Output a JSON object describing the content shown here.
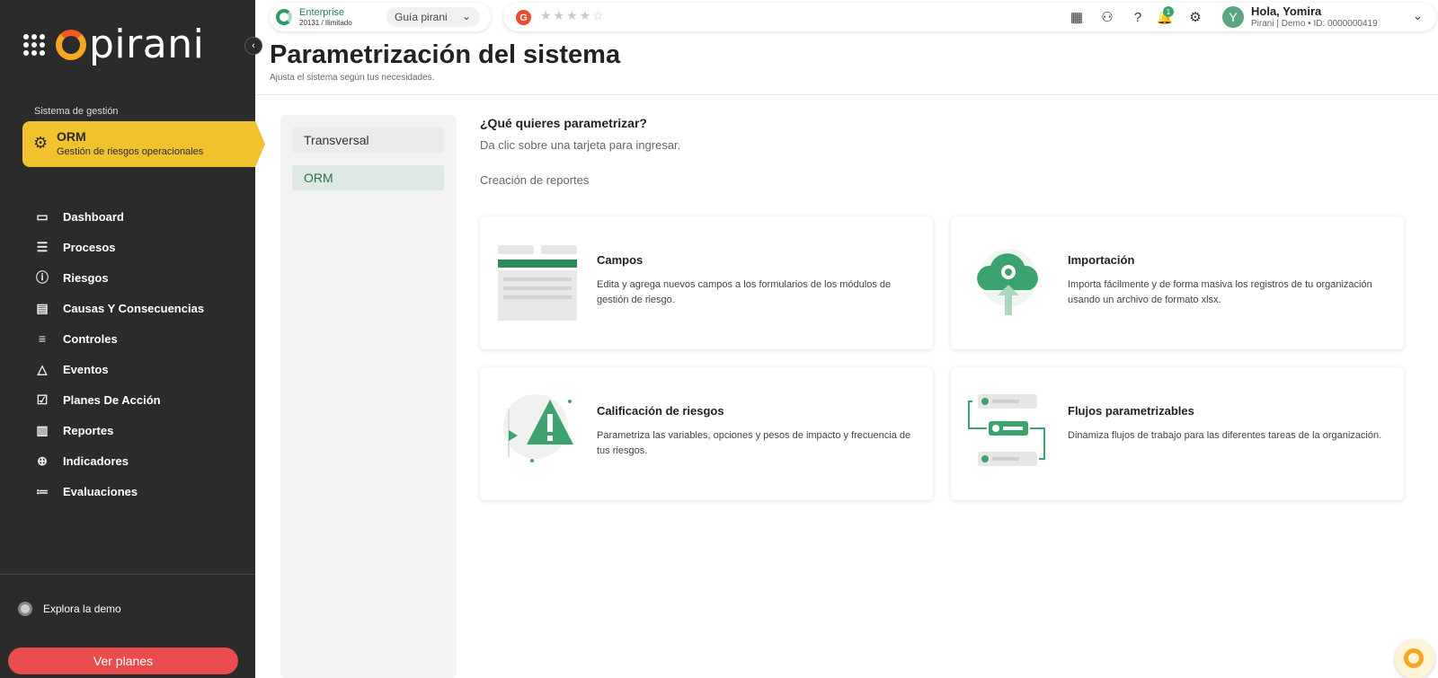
{
  "brand": {
    "logo_text": "pirani"
  },
  "sidebar": {
    "section_label": "Sistema de gestión",
    "active_module": {
      "title": "ORM",
      "subtitle": "Gestión de riesgos operacionales"
    },
    "items": [
      {
        "label": "Dashboard",
        "icon": "monitor-icon"
      },
      {
        "label": "Procesos",
        "icon": "list-icon"
      },
      {
        "label": "Riesgos",
        "icon": "alert-circle-icon"
      },
      {
        "label": "Causas Y Consecuencias",
        "icon": "cause-icon"
      },
      {
        "label": "Controles",
        "icon": "sliders-icon"
      },
      {
        "label": "Eventos",
        "icon": "warning-icon"
      },
      {
        "label": "Planes De Acción",
        "icon": "checklist-icon"
      },
      {
        "label": "Reportes",
        "icon": "chart-icon"
      },
      {
        "label": "Indicadores",
        "icon": "crosshair-icon"
      },
      {
        "label": "Evaluaciones",
        "icon": "evaluation-icon"
      }
    ],
    "explore_label": "Explora la demo",
    "plans_button": "Ver planes"
  },
  "topbar": {
    "plan_name": "Enterprise",
    "plan_detail": "20131 / Ilimitado",
    "guide_label": "Guía pirani",
    "rating_stars": 4,
    "notification_count": "1",
    "avatar_letter": "Y",
    "greeting": "Hola, Yomira",
    "user_info": "Pirani | Demo • ID: 0000000419"
  },
  "header": {
    "title": "Parametrización del sistema",
    "subtitle": "Ajusta el sistema según tus necesidades."
  },
  "left_panel": {
    "items": [
      "Transversal",
      "ORM"
    ]
  },
  "main": {
    "question": "¿Qué quieres parametrizar?",
    "instruction": "Da clic sobre una tarjeta para ingresar.",
    "section_label": "Creación de reportes",
    "cards": [
      {
        "title": "Campos",
        "description": "Edita y agrega nuevos campos a los formularios de los módulos de gestión de riesgo."
      },
      {
        "title": "Importación",
        "description": "Importa fácilmente y de forma masiva los registros de tu organización usando un archivo de formato xlsx."
      },
      {
        "title": "Calificación de riesgos",
        "description": "Parametriza las variables, opciones y pesos de impacto y frecuencia de tus riesgos."
      },
      {
        "title": "Flujos parametrizables",
        "description": "Dinamiza flujos de trabajo para las diferentes tareas de la organización."
      }
    ]
  },
  "colors": {
    "accent_yellow": "#f2c12e",
    "brand_green": "#3da36e",
    "danger_red": "#e84c4c",
    "sidebar_bg": "#2b2b2b"
  }
}
